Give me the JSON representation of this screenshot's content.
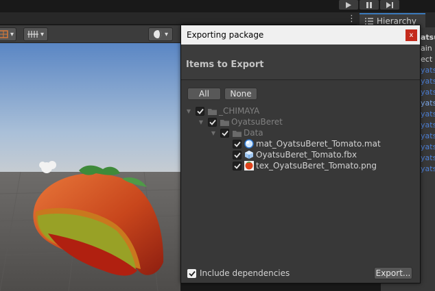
{
  "topbar": {
    "play_icon": "play-icon",
    "pause_icon": "pause-icon",
    "step_icon": "step-icon"
  },
  "hierarchy": {
    "tab_label": "Hierarchy",
    "partial_lines": [
      "atsuB",
      "ain",
      "ect",
      "yats",
      "yats",
      "yats",
      "yats",
      "yats",
      "yats",
      "yats",
      "yats",
      "yats",
      "yats"
    ]
  },
  "dialog": {
    "title": "Exporting package",
    "close_label": "x",
    "header": "Items to Export",
    "all_label": "All",
    "none_label": "None",
    "tree": [
      {
        "label": "_CHIMAYA",
        "icon": "folder-icon",
        "dim": true,
        "arrow": true
      },
      {
        "label": "OyatsuBeret",
        "icon": "folder-icon",
        "dim": true,
        "arrow": true
      },
      {
        "label": "Data",
        "icon": "folder-icon",
        "dim": true,
        "arrow": true
      },
      {
        "label": "mat_OyatsuBeret_Tomato.mat",
        "icon": "material-icon",
        "dim": false,
        "arrow": false
      },
      {
        "label": "OyatsuBeret_Tomato.fbx",
        "icon": "model-icon",
        "dim": false,
        "arrow": false
      },
      {
        "label": "tex_OyatsuBeret_Tomato.png",
        "icon": "texture-icon",
        "dim": false,
        "arrow": false
      }
    ],
    "include_dependencies_label": "Include dependencies",
    "export_label": "Export..."
  },
  "colors": {
    "accent": "#3a79bb",
    "close_red": "#c42b1c",
    "link_blue": "#4c7fd6"
  }
}
